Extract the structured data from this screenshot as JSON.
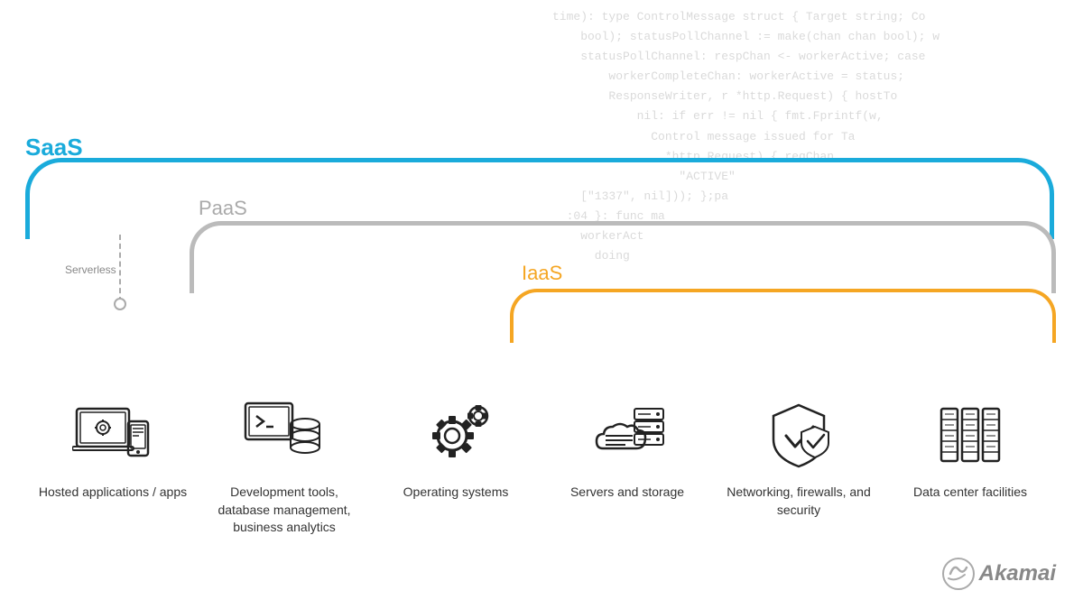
{
  "labels": {
    "saas": "SaaS",
    "paas": "PaaS",
    "iaas": "IaaS",
    "serverless": "Serverless",
    "akamai": "Akamai"
  },
  "colors": {
    "saas": "#1aabdb",
    "paas": "#aaaaaa",
    "iaas": "#f5a623",
    "text": "#333333",
    "muted": "#888888"
  },
  "items": [
    {
      "id": "hosted-apps",
      "label": "Hosted applications / apps",
      "icon": "laptop-phone"
    },
    {
      "id": "dev-tools",
      "label": "Development tools, database management, business analytics",
      "icon": "database-code"
    },
    {
      "id": "os",
      "label": "Operating systems",
      "icon": "gear"
    },
    {
      "id": "servers",
      "label": "Servers and storage",
      "icon": "server-stack"
    },
    {
      "id": "networking",
      "label": "Networking, firewalls, and security",
      "icon": "shield-check"
    },
    {
      "id": "datacenter",
      "label": "Data center facilities",
      "icon": "datacenter"
    }
  ],
  "code_lines": [
    "time): type ControlMessage struct { Target string; Co",
    "bool); statusPollChannel := make(chan chan bool); w",
    "statusPollChannel: respChan <- workerActive; case",
    "      workerCompleteChan: workerActive = status;",
    "      ResponseWriter, r *http.Request) { hostTo",
    "        nil: if err != nil { fmt.Fprintf(w,",
    "          Control message issued for Ta",
    "            *http.Request) { reqChan",
    "              \"ACTIVE\"",
    "    [\"1337\", nil])); };pa",
    "  :04 }: func ma",
    "    workerAct",
    "      doing"
  ]
}
